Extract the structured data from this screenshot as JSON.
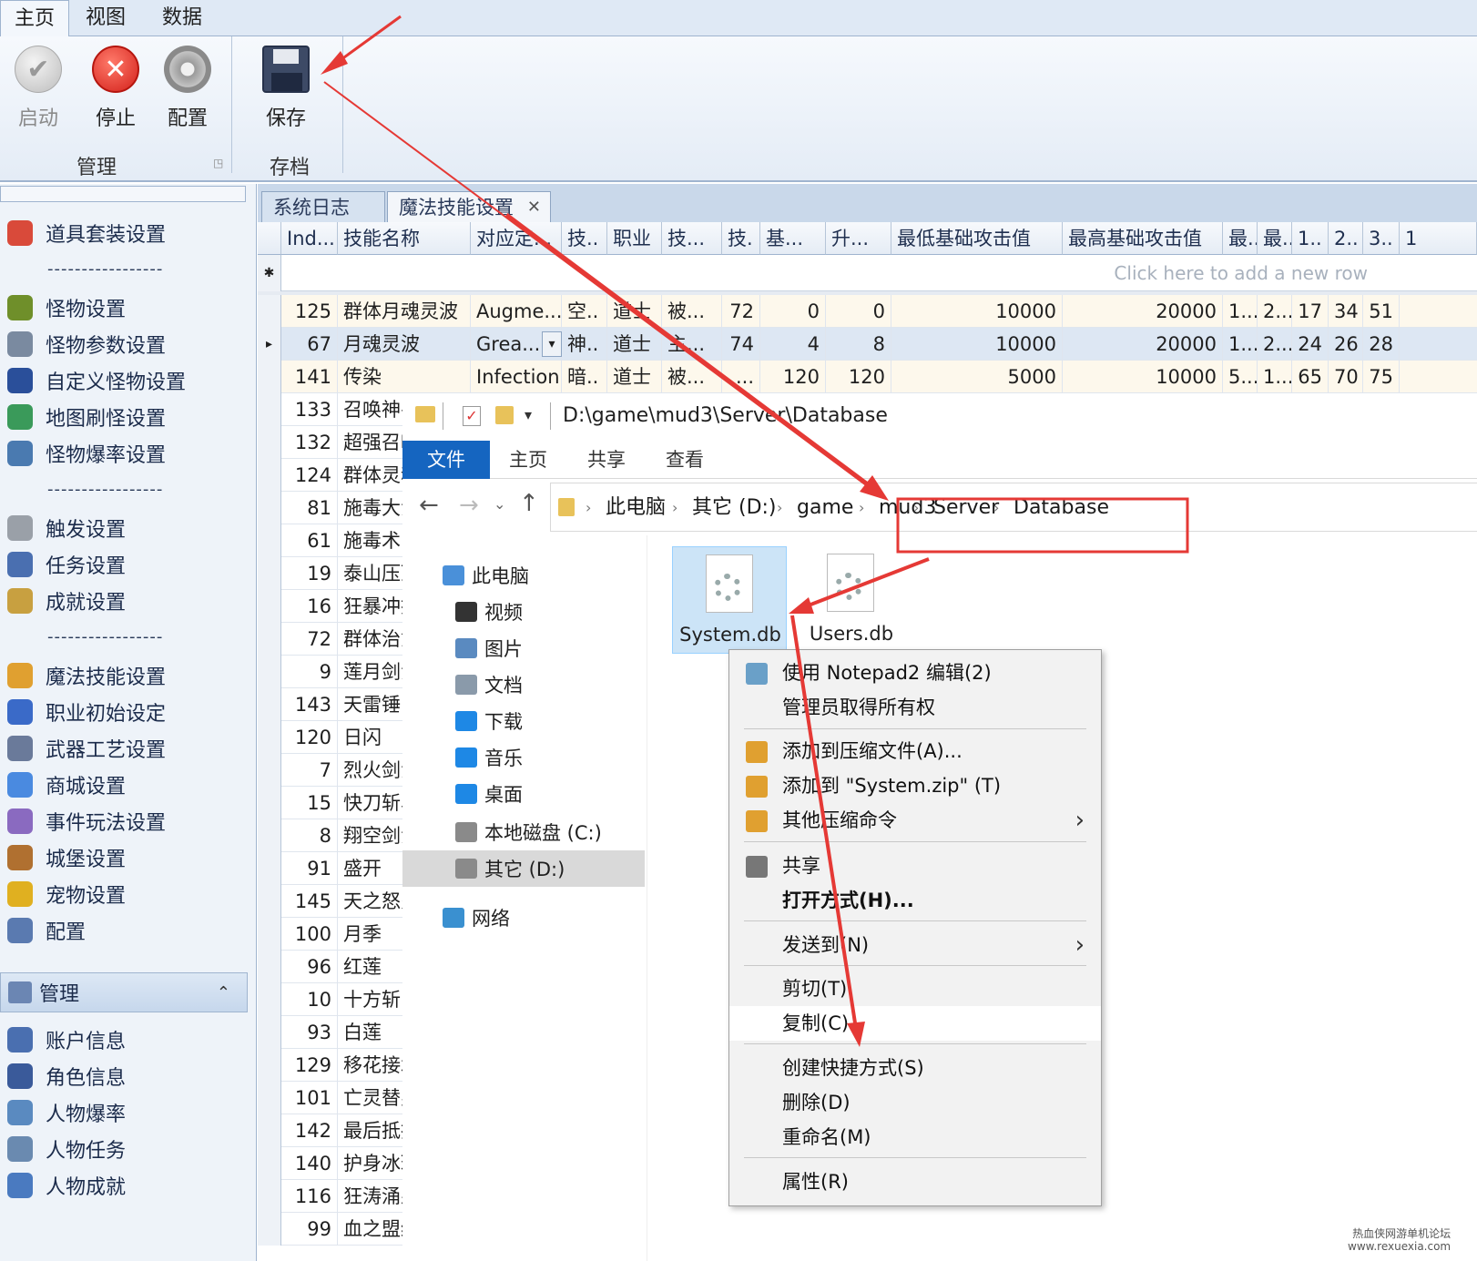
{
  "ribbon": {
    "tabs": [
      "主页",
      "视图",
      "数据"
    ],
    "buttons": {
      "start": "启动",
      "stop": "停止",
      "config": "配置",
      "save": "保存"
    },
    "groups": {
      "manage": "管理",
      "archive": "存档"
    }
  },
  "nav": {
    "items": [
      "道具套装设置",
      "怪物设置",
      "怪物参数设置",
      "自定义怪物设置",
      "地图刷怪设置",
      "怪物爆率设置",
      "触发设置",
      "任务设置",
      "成就设置",
      "魔法技能设置",
      "职业初始设定",
      "武器工艺设置",
      "商城设置",
      "事件玩法设置",
      "城堡设置",
      "宠物设置",
      "配置"
    ],
    "separator": "-----------------",
    "section_header": "管理",
    "manage_items": [
      "账户信息",
      "角色信息",
      "人物爆率",
      "人物任务",
      "人物成就"
    ]
  },
  "doc_tabs": [
    "系统日志",
    "魔法技能设置"
  ],
  "grid": {
    "headers": [
      "Ind...",
      "技能名称",
      "对应定...",
      "技..",
      "职业",
      "技...",
      "技.",
      "基...",
      "升...",
      "最低基础攻击值",
      "最高基础攻击值",
      "最..",
      "最..",
      "1..",
      "2..",
      "3..",
      "1"
    ],
    "new_row": "Click here to add a new row",
    "new_row_marker": "✱",
    "current_marker": "▸",
    "full_rows": [
      [
        "125",
        "群体月魂灵波",
        "Augme...",
        "空..",
        "道士",
        "被...",
        "72",
        "0",
        "0",
        "10000",
        "20000",
        "1...",
        "2...",
        "17",
        "34",
        "51"
      ],
      [
        "67",
        "月魂灵波",
        "Grea...",
        "神..",
        "道士",
        "主...",
        "74",
        "4",
        "8",
        "10000",
        "20000",
        "1...",
        "2...",
        "24",
        "26",
        "28"
      ],
      [
        "141",
        "传染",
        "Infection",
        "暗..",
        "道士",
        "被...",
        "...",
        "120",
        "120",
        "5000",
        "10000",
        "5...",
        "1...",
        "65",
        "70",
        "75"
      ]
    ],
    "rows": [
      [
        "133",
        "召唤神兽"
      ],
      [
        "132",
        "超强召唤"
      ],
      [
        "124",
        "群体灵魂"
      ],
      [
        "81",
        "施毒大法"
      ],
      [
        "61",
        "施毒术"
      ],
      [
        "19",
        "泰山压顶"
      ],
      [
        "16",
        "狂暴冲撞"
      ],
      [
        "72",
        "群体治愈"
      ],
      [
        "9",
        "莲月剑法"
      ],
      [
        "143",
        "天雷锤"
      ],
      [
        "120",
        "日闪"
      ],
      [
        "7",
        "烈火剑法"
      ],
      [
        "15",
        "快刀斩马"
      ],
      [
        "8",
        "翔空剑法"
      ],
      [
        "91",
        "盛开"
      ],
      [
        "145",
        "天之怒火"
      ],
      [
        "100",
        "月季"
      ],
      [
        "96",
        "红莲"
      ],
      [
        "10",
        "十方斩"
      ],
      [
        "93",
        "白莲"
      ],
      [
        "129",
        "移花接木"
      ],
      [
        "101",
        "亡灵替身"
      ],
      [
        "142",
        "最后抵抗"
      ],
      [
        "140",
        "护身冰环"
      ],
      [
        "116",
        "狂涛涌泉"
      ],
      [
        "99",
        "血之盟约"
      ]
    ]
  },
  "explorer": {
    "title_path": "D:\\game\\mud3\\Server\\Database",
    "tabs": [
      "文件",
      "主页",
      "共享",
      "查看"
    ],
    "breadcrumb": [
      "此电脑",
      "其它 (D:)",
      "game",
      "mud3",
      "Server",
      "Database"
    ],
    "tree": [
      "此电脑",
      "视频",
      "图片",
      "文档",
      "下载",
      "音乐",
      "桌面",
      "本地磁盘 (C:)",
      "其它 (D:)",
      "网络"
    ],
    "files": [
      "System.db",
      "Users.db"
    ]
  },
  "context_menu": {
    "items": [
      "使用 Notepad2 编辑(2)",
      "管理员取得所有权",
      "添加到压缩文件(A)...",
      "添加到 \"System.zip\" (T)",
      "其他压缩命令",
      "共享",
      "打开方式(H)...",
      "发送到(N)",
      "剪切(T)",
      "复制(C)",
      "创建快捷方式(S)",
      "删除(D)",
      "重命名(M)",
      "属性(R)"
    ]
  },
  "watermark": "热血侠网游单机论坛\nwww.rexuexia.com",
  "colors": {
    "accent": "#1565c0",
    "highlight": "#e53935",
    "ribbon": "#dfe9f5"
  }
}
